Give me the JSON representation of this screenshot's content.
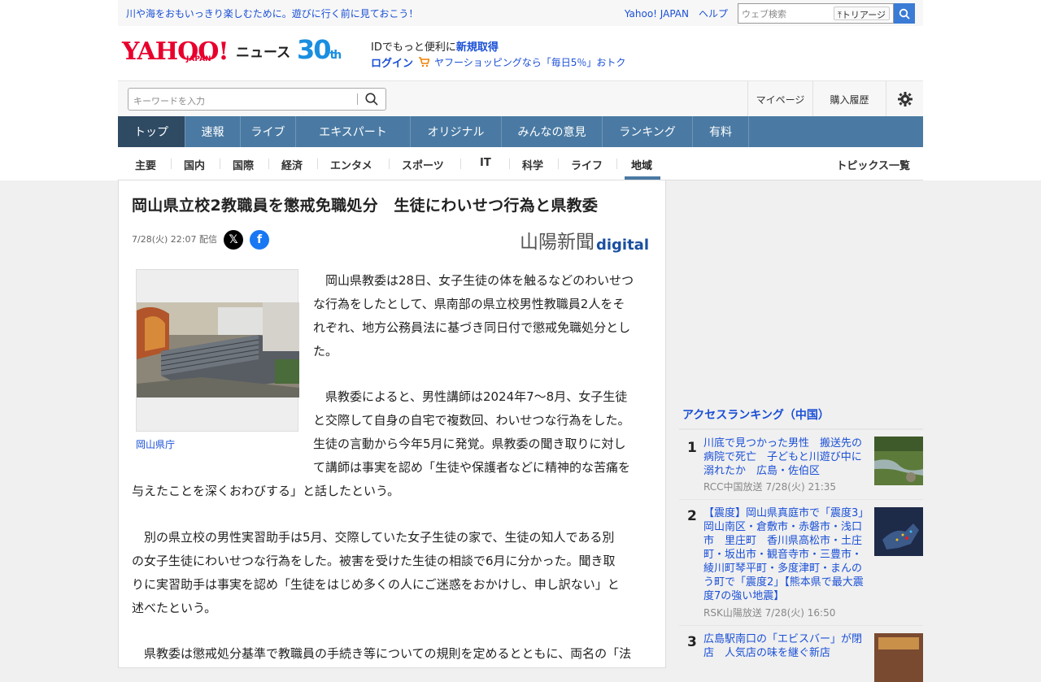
{
  "promo": {
    "text": "川や海をおもいっきり楽しむために。遊びに行く前に見ておこう！",
    "yahoo_japan": "Yahoo! JAPAN",
    "help": "ヘルプ",
    "search_placeholder": "ウェブ検索",
    "triage": "トリアージ"
  },
  "header": {
    "logo": "YAHOO!",
    "logo_sub": "JAPAN",
    "news": "ニュース",
    "anniv": "30",
    "anniv_suffix": "th",
    "id_text": "IDでもっと便利に",
    "id_link": "新規取得",
    "login": "ログイン",
    "shopping": "ヤフーショッピングなら「毎日5％」おトク"
  },
  "search": {
    "placeholder": "キーワードを入力",
    "mypage": "マイページ",
    "history": "購入履歴"
  },
  "mainnav": [
    "トップ",
    "速報",
    "ライブ",
    "エキスパート",
    "オリジナル",
    "みんなの意見",
    "ランキング",
    "有料"
  ],
  "subnav": [
    "主要",
    "国内",
    "国際",
    "経済",
    "エンタメ",
    "スポーツ",
    "IT",
    "科学",
    "ライフ",
    "地域"
  ],
  "topics": "トピックス一覧",
  "article": {
    "title": "岡山県立校2教職員を懲戒免職処分　生徒にわいせつ行為と県教委",
    "datetime": "7/28(火) 22:07",
    "delivered": "配信",
    "publisher": "山陽新聞",
    "publisher_digital": "digital",
    "caption": "岡山県庁",
    "p1_line1": "　岡山県教委は28日、女子生徒の体を触るなどのわいせつ",
    "p1_line2": "な行為をしたとして、県南部の県立校男性教職員2人をそ",
    "p1_line3": "れぞれ、地方公務員法に基づき同日付で懲戒免職処分とし",
    "p1_line4": "た。",
    "p2_line1": "　県教委によると、男性講師は2024年7～8月、女子生徒",
    "p2_line2": "と交際して自身の自宅で複数回、わいせつな行為をした。",
    "p2_line3": "生徒の言動から今年5月に発覚。県教委の聞き取りに対し",
    "p2_line4": "て講師は事実を認め「生徒や保護者などに精神的な苦痛を",
    "p2_line5": "与えたことを深くおわびする」と話したという。",
    "p3_line1": "　別の県立校の男性実習助手は5月、交際していた女子生徒の家で、生徒の知人である別",
    "p3_line2": "の女子生徒にわいせつな行為をした。被害を受けた生徒の相談で6月に分かった。聞き取",
    "p3_line3": "りに実習助手は事実を認め「生徒をはじめ多くの人にご迷惑をおかけし、申し訳ない」と",
    "p3_line4": "述べたという。",
    "p4_line1": "　県教委は懲戒処分基準で教職員の手続き等についての規則を定めるとともに、両名の「法"
  },
  "ranking": {
    "heading": "アクセスランキング（中国）",
    "items": [
      {
        "num": "1",
        "title": "川底で見つかった男性　搬送先の病院で死亡　子どもと川遊び中に溺れたか　広島・佐伯区",
        "source": "RCC中国放送",
        "time": "7/28(火) 21:35"
      },
      {
        "num": "2",
        "title": "【震度】岡山県真庭市で「震度3」　岡山南区・倉敷市・赤磐市・浅口市　里庄町　香川県高松市・土庄町・坂出市・観音寺市・三豊市・綾川町琴平町・多度津町・まんのう町で「震度2」【熊本県で最大震度7の強い地震】",
        "source": "RSK山陽放送",
        "time": "7/28(火) 16:50"
      },
      {
        "num": "3",
        "title": "広島駅南口の「エビスバー」が閉店　人気店の味を継ぐ新店",
        "source": "",
        "time": ""
      }
    ]
  },
  "colors": {
    "nav": "#4a7aa3",
    "nav_active": "#2f4a63",
    "link": "#1a4fd6",
    "brand": "#e8002d"
  }
}
